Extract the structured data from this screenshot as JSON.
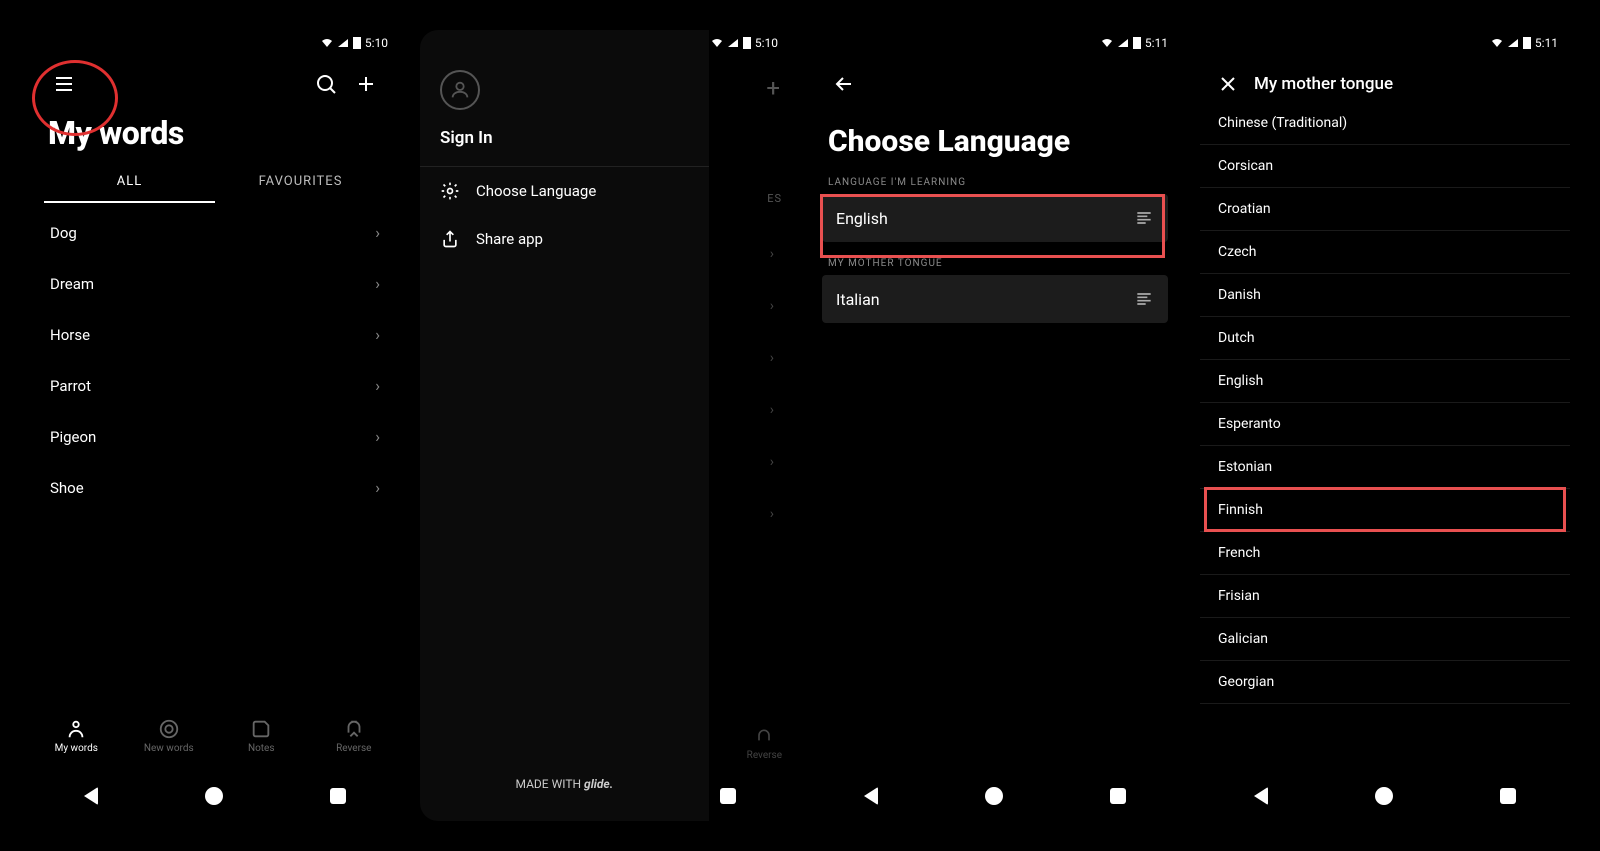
{
  "status": {
    "time1": "5:10",
    "time2": "5:11"
  },
  "screen1": {
    "title": "My words",
    "tabs": [
      "ALL",
      "FAVOURITES"
    ],
    "active_tab": 0,
    "words": [
      "Dog",
      "Dream",
      "Horse",
      "Parrot",
      "Pigeon",
      "Shoe"
    ],
    "nav": [
      "My words",
      "New words",
      "Notes",
      "Reverse"
    ]
  },
  "screen2": {
    "signin": "Sign In",
    "items": [
      "Choose Language",
      "Share app"
    ],
    "madewith_prefix": "MADE WITH ",
    "madewith_brand": "glide.",
    "ghost_tab": "ES",
    "ghost_nav": "Reverse"
  },
  "screen3": {
    "title": "Choose Language",
    "learning_label": "LANGUAGE I'M LEARNING",
    "learning_value": "English",
    "mother_label": "MY MOTHER TONGUE",
    "mother_value": "Italian"
  },
  "screen4": {
    "title": "My mother tongue",
    "languages": [
      "Chinese (Traditional)",
      "Corsican",
      "Croatian",
      "Czech",
      "Danish",
      "Dutch",
      "English",
      "Esperanto",
      "Estonian",
      "Finnish",
      "French",
      "Frisian",
      "Galician",
      "Georgian"
    ],
    "highlight_index": 9
  }
}
